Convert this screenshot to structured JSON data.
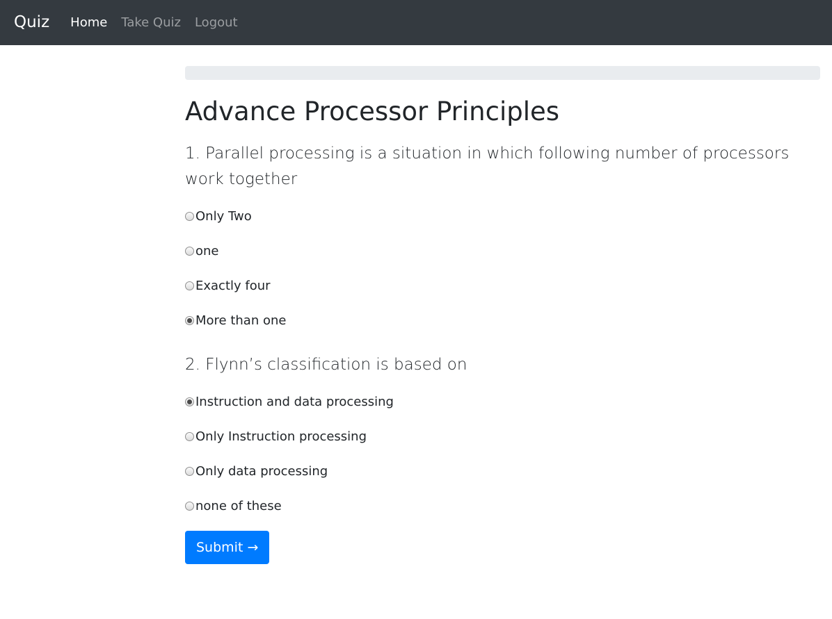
{
  "navbar": {
    "brand": "Quiz",
    "links": [
      {
        "label": "Home",
        "active": true
      },
      {
        "label": "Take Quiz",
        "active": false
      },
      {
        "label": "Logout",
        "active": false
      }
    ]
  },
  "progress": {
    "fraction": 0
  },
  "page": {
    "title": "Advance Processor Principles",
    "questions": [
      {
        "text": "1. Parallel processing is a situation in which following number of processors work together",
        "options": [
          {
            "label": "Only Two",
            "selected": false
          },
          {
            "label": "one",
            "selected": false
          },
          {
            "label": "Exactly four",
            "selected": false
          },
          {
            "label": "More than one",
            "selected": true
          }
        ]
      },
      {
        "text": "2. Flynn’s classification is based on",
        "options": [
          {
            "label": "Instruction and data processing",
            "selected": true
          },
          {
            "label": "Only Instruction processing",
            "selected": false
          },
          {
            "label": "Only data processing",
            "selected": false
          },
          {
            "label": "none of these",
            "selected": false
          }
        ]
      }
    ],
    "submit_label": "Submit →"
  },
  "colors": {
    "navbar_bg": "#343a40",
    "primary": "#007bff",
    "progress_track": "#e9ecef"
  }
}
